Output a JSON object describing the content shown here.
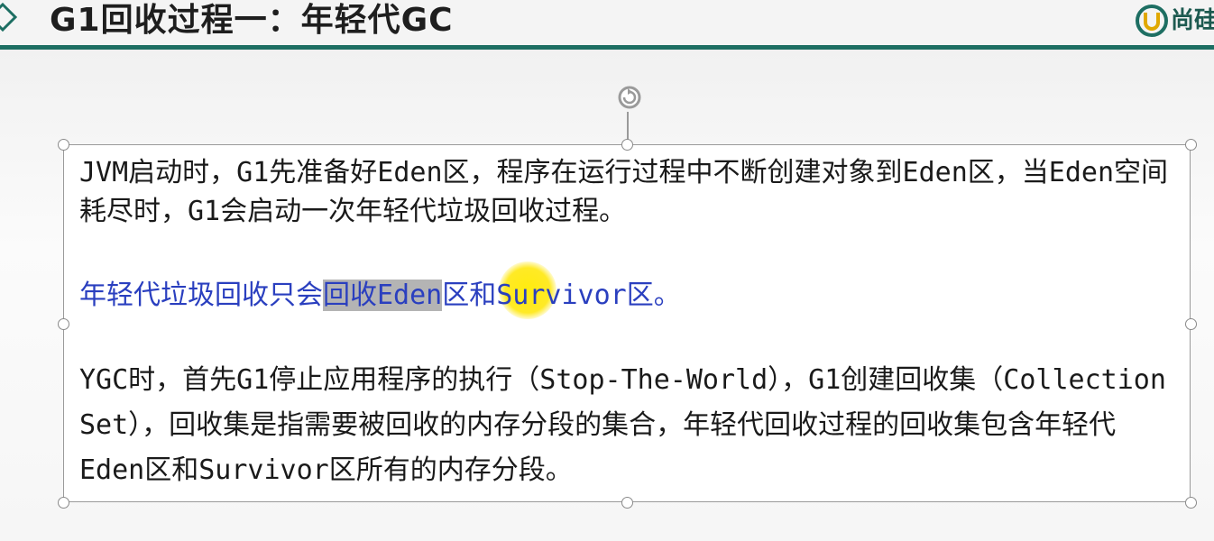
{
  "header": {
    "title": "G1回收过程一：年轻代GC",
    "logo_text": "尚硅"
  },
  "content": {
    "paragraph1": "JVM启动时，G1先准备好Eden区，程序在运行过程中不断创建对象到Eden区，当Eden空间耗尽时，G1会启动一次年轻代垃圾回收过程。",
    "paragraph2_before": "年轻代垃圾回收只会",
    "paragraph2_selected": "回收Eden",
    "paragraph2_after": "区和Survivor区。",
    "paragraph3": "YGC时，首先G1停止应用程序的执行（Stop-The-World），G1创建回收集（Collection Set），回收集是指需要被回收的内存分段的集合，年轻代回收过程的回收集包含年轻代Eden区和Survivor区所有的内存分段。"
  },
  "colors": {
    "accent": "#1d6e62",
    "highlight_text": "#2a3fbf",
    "cursor_highlight": "#ffe600"
  }
}
